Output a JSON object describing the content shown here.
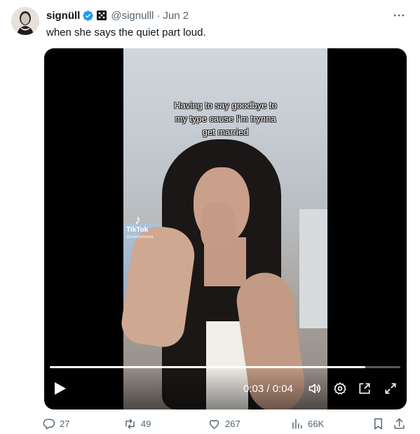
{
  "author": {
    "display_name": "signüll",
    "handle": "@signulll",
    "separator": "·",
    "date": "Jun 2"
  },
  "tweet": {
    "text": "when she says the quiet part loud."
  },
  "video": {
    "caption_lines": [
      "Having to say goodbye to",
      "my type cause I'm trynna",
      "get married"
    ],
    "watermark_name": "TikTok",
    "watermark_user": "@seenafseeni",
    "time_display": "0:03 / 0:04",
    "progress": 0.9
  },
  "stats": {
    "replies": "27",
    "reposts": "49",
    "likes": "267",
    "views": "66K"
  },
  "icons": [
    "verified-badge-icon",
    "affiliate-badge-icon",
    "more-icon",
    "play-icon",
    "volume-icon",
    "settings-icon",
    "popout-icon",
    "fullscreen-icon",
    "reply-icon",
    "repost-icon",
    "like-icon",
    "views-icon",
    "bookmark-icon",
    "share-icon"
  ],
  "colors": {
    "verified": "#1d9bf0",
    "secondary_text": "#536471",
    "primary_text": "#0f1419"
  }
}
